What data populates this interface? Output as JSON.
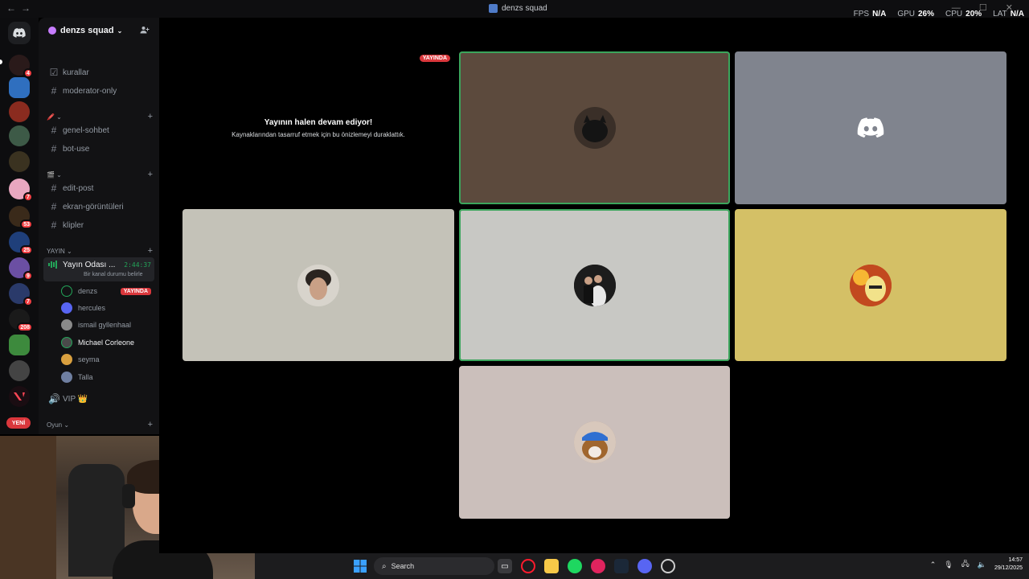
{
  "window": {
    "title": "denzs squad",
    "controls": "—  ☐  ✕"
  },
  "overlay": {
    "fps_label": "FPS",
    "fps_value": "N/A",
    "gpu_label": "GPU",
    "gpu_value": "26%",
    "cpu_label": "CPU",
    "cpu_value": "20%",
    "lat_label": "LAT",
    "lat_value": "N/A"
  },
  "rail": {
    "badges": [
      "4",
      "",
      "",
      "",
      "",
      "7",
      "53",
      "25",
      "9",
      "7",
      "208",
      "",
      "",
      ""
    ],
    "new_label": "YENİ"
  },
  "sidebar": {
    "server_name": "denzs squad",
    "channels_top": [
      {
        "name": "kurallar",
        "icon": "rules-icon"
      },
      {
        "name": "moderator-only",
        "icon": "hash-icon"
      }
    ],
    "category1": "🖍️ ⌄",
    "channels_mid": [
      {
        "name": "genel-sohbet"
      },
      {
        "name": "bot-use"
      }
    ],
    "category2": "🎬 ⌄",
    "channels_bottom": [
      {
        "name": "edit-post"
      },
      {
        "name": "ekran-görüntüleri"
      },
      {
        "name": "klipler"
      }
    ],
    "category_yayin": "YAYIN",
    "voice_channel": {
      "name": "Yayın Odası ...",
      "timer": "2:44:37",
      "status": "Bir kanal durumu belirle"
    },
    "voice_users": [
      {
        "name": "denzs",
        "live": "YAYINDA",
        "bright": false,
        "color": "#2a2a2a"
      },
      {
        "name": "hercules",
        "live": "",
        "bright": false,
        "color": "#5865f2"
      },
      {
        "name": "ismail gyllenhaal",
        "live": "",
        "bright": false,
        "color": "#8a8a8a"
      },
      {
        "name": "Michael Corleone",
        "live": "",
        "bright": true,
        "color": "#4a4a4a"
      },
      {
        "name": "seyma",
        "live": "",
        "bright": false,
        "color": "#d9a03f"
      },
      {
        "name": "Talla",
        "live": "",
        "bright": false,
        "color": "#6f7fa1"
      }
    ],
    "vip_channel": "VIP 👑",
    "category_oyun": "Oyun"
  },
  "stage": {
    "paused_live_tag": "YAYINDA",
    "paused_heading": "Yayının halen devam ediyor!",
    "paused_sub": "Kaynaklarından tasarruf etmek için bu önizlemeyi duraklattık.",
    "colors": {
      "tile1": "#5c4a3d",
      "tile2": "#80848e",
      "tile3": "#c4c2b8",
      "tile4": "#c8c8c4",
      "tile5": "#d4c066",
      "tile6": "#cbbfbb",
      "speaking": "#3ba55c"
    }
  },
  "taskbar": {
    "search_label": "Search",
    "time": "14:57",
    "date": "29/12/2025"
  }
}
